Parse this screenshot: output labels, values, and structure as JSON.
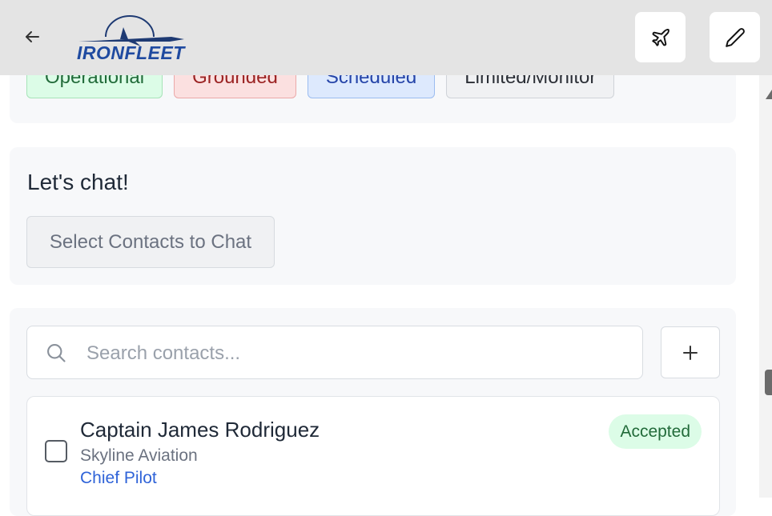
{
  "header": {
    "logo_text": "IRONFLEET",
    "back_icon": "arrow-left-icon",
    "plane_icon": "plane-icon",
    "edit_icon": "pencil-icon"
  },
  "status_filters": [
    {
      "label": "Operational",
      "color": "#226b3a"
    },
    {
      "label": "Grounded",
      "color": "#9b2323"
    },
    {
      "label": "Scheduled",
      "color": "#2544a8"
    },
    {
      "label": "Limited/Monitor",
      "color": "#2b2f36"
    }
  ],
  "chat": {
    "title": "Let's chat!",
    "select_button_label": "Select Contacts to Chat"
  },
  "contacts": {
    "search_placeholder": "Search contacts...",
    "search_value": "",
    "add_icon": "plus-icon",
    "items": [
      {
        "name": "Captain James Rodriguez",
        "company": "Skyline Aviation",
        "role": "Chief Pilot",
        "status": "Accepted",
        "checked": false
      }
    ]
  },
  "colors": {
    "header_bg": "#e4e4e4",
    "card_bg": "#f7f8fa",
    "accent_blue": "#2f63d8",
    "success_green": "#226b3a"
  }
}
